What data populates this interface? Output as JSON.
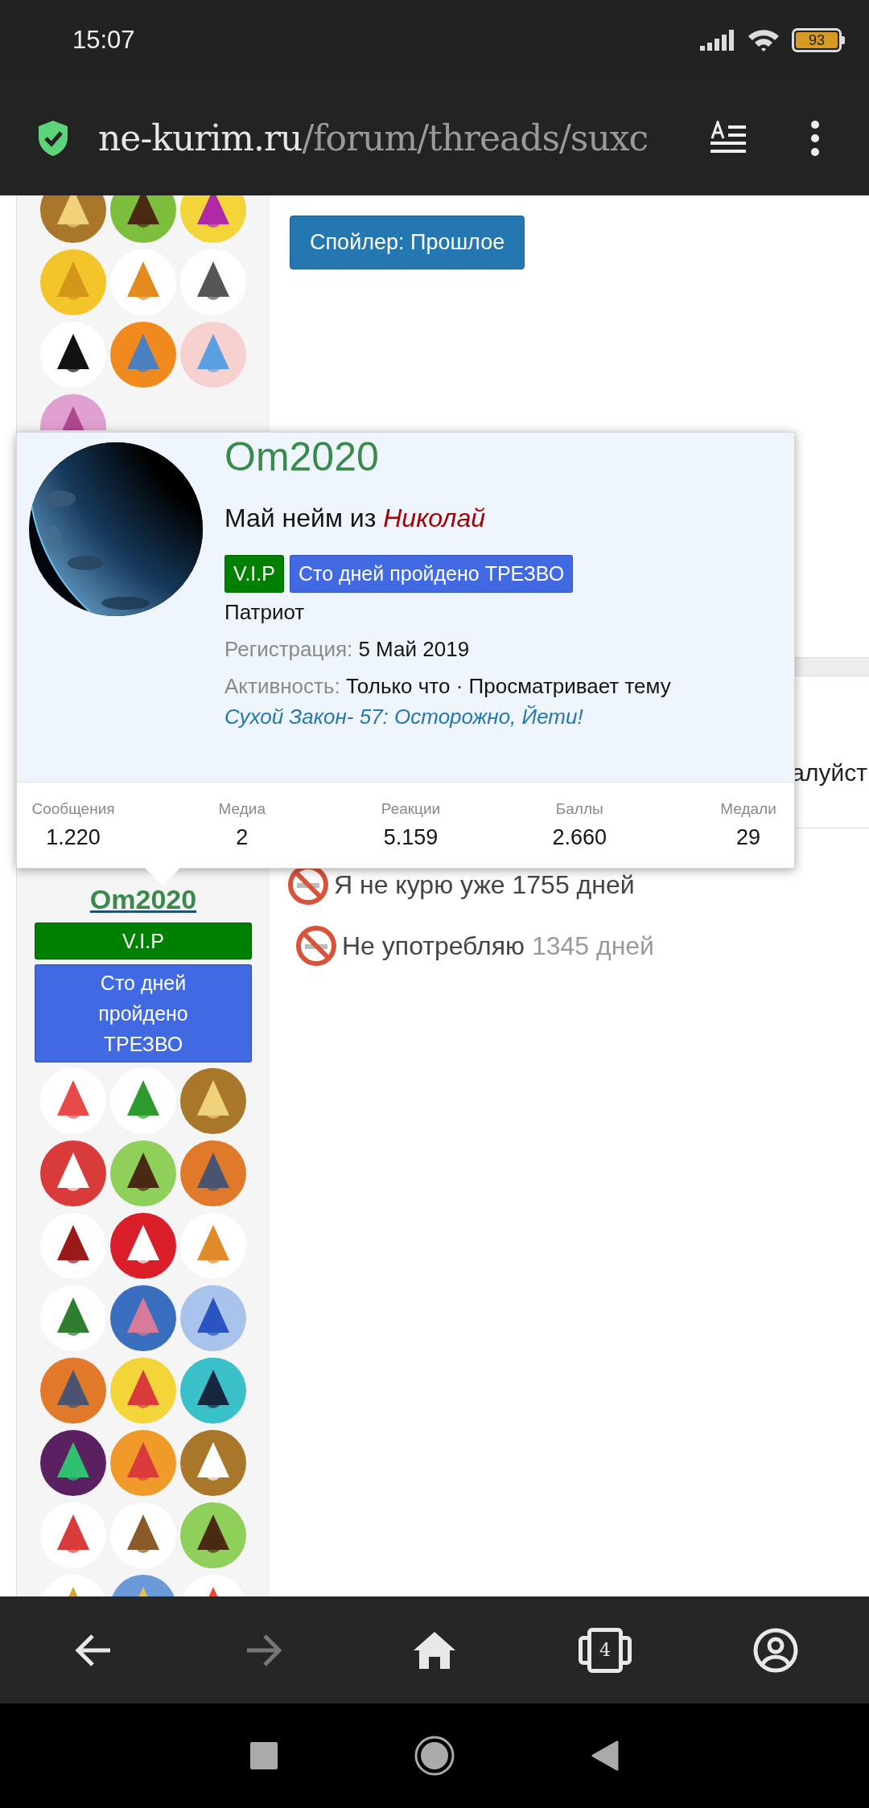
{
  "status_bar": {
    "time": "15:07",
    "battery": "93"
  },
  "browser": {
    "url_domain": "ne-kurim.ru",
    "url_path": "/forum/threads/suxc"
  },
  "post_above": {
    "spoiler_button": "Спойлер: Прошлое"
  },
  "post_text_fragment": "алуйст",
  "signatures": [
    {
      "label": "Я не курю уже",
      "count": "1755 дней",
      "color": "#444444"
    },
    {
      "label": "Не употребляю",
      "count": "1345 дней",
      "color": "#9a9a9a"
    }
  ],
  "profile_popup": {
    "name": "Om2020",
    "tagline": "Май нейм из",
    "tagline_name": "Николай",
    "badges": [
      {
        "label": "V.I.P",
        "color": "#008000"
      },
      {
        "label": "Сто дней пройдено ТРЕЗВО",
        "color": "#4169e1"
      }
    ],
    "title": "Патриот",
    "registration": {
      "label": "Регистрация:",
      "value": "5 Май 2019"
    },
    "activity": {
      "label": "Активность:",
      "value": "Только что · Просматривает тему"
    },
    "activity_link": "Сухой Закон- 57: Осторожно, Йети!",
    "stats": [
      {
        "label": "Сообщения",
        "value": "1.220"
      },
      {
        "label": "Медиа",
        "value": "2"
      },
      {
        "label": "Реакции",
        "value": "5.159"
      },
      {
        "label": "Баллы",
        "value": "2.660"
      },
      {
        "label": "Медали",
        "value": "29"
      }
    ]
  },
  "post_author": {
    "name": "Om2020",
    "badges": [
      {
        "label": "V.I.P",
        "color": "#008000"
      },
      {
        "label": "Сто дней пройдено ТРЕЗВО",
        "color": "#4169e1"
      }
    ]
  },
  "bottom_nav": [
    {
      "kind": "back",
      "disabled": false
    },
    {
      "kind": "forward",
      "disabled": true
    },
    {
      "kind": "home",
      "disabled": false
    },
    {
      "kind": "tabs",
      "count": "4",
      "disabled": false
    },
    {
      "kind": "account",
      "disabled": false
    }
  ]
}
